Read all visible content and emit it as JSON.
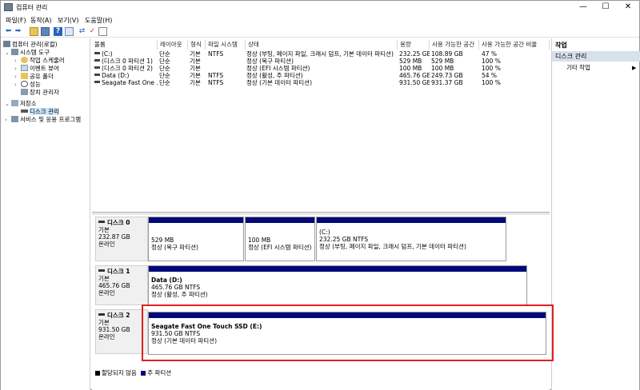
{
  "window": {
    "title": "컴퓨터 관리",
    "minimize": "—",
    "maximize": "☐",
    "close": "✕"
  },
  "menu": [
    "파일(F)",
    "동작(A)",
    "보기(V)",
    "도움말(H)"
  ],
  "tree": {
    "root": "컴퓨터 관리(로컬)",
    "system_tools": "시스템 도구",
    "task_scheduler": "작업 스케줄러",
    "event_viewer": "이벤트 뷰어",
    "shared_folders": "공유 폴더",
    "performance": "성능",
    "device_manager": "장치 관리자",
    "storage": "저장소",
    "disk_management": "디스크 관리",
    "services": "서비스 및 응용 프로그램"
  },
  "volume_table": {
    "columns": [
      "볼륨",
      "레이아웃",
      "형식",
      "파일 시스템",
      "상태",
      "용량",
      "사용 가능한 공간",
      "사용 가능한 공간 비율"
    ],
    "rows": [
      {
        "volume": "(C:)",
        "layout": "단순",
        "type": "기본",
        "fs": "NTFS",
        "status": "정상 (부팅, 페이지 파일, 크래시 덤프, 기본 데이터 파티션)",
        "capacity": "232.25 GB",
        "free": "108.89 GB",
        "pct": "47 %"
      },
      {
        "volume": "(디스크 0 파티션 1)",
        "layout": "단순",
        "type": "기본",
        "fs": "",
        "status": "정상 (복구 파티션)",
        "capacity": "529 MB",
        "free": "529 MB",
        "pct": "100 %"
      },
      {
        "volume": "(디스크 0 파티션 2)",
        "layout": "단순",
        "type": "기본",
        "fs": "",
        "status": "정상 (EFI 시스템 파티션)",
        "capacity": "100 MB",
        "free": "100 MB",
        "pct": "100 %"
      },
      {
        "volume": "Data (D:)",
        "layout": "단순",
        "type": "기본",
        "fs": "NTFS",
        "status": "정상 (활성, 주 파티션)",
        "capacity": "465.76 GB",
        "free": "249.73 GB",
        "pct": "54 %"
      },
      {
        "volume": "Seagate Fast One ...",
        "layout": "단순",
        "type": "기본",
        "fs": "NTFS",
        "status": "정상 (기본 데이터 파티션)",
        "capacity": "931.50 GB",
        "free": "931.37 GB",
        "pct": "100 %"
      }
    ]
  },
  "disks": [
    {
      "name": "디스크 0",
      "kind": "기본",
      "size": "232.87 GB",
      "state": "온라인",
      "partitions": [
        {
          "line1": "529 MB",
          "line2": "정상 (복구 파티션)"
        },
        {
          "line1": "100 MB",
          "line2": "정상 (EFI 시스템 파티션)"
        },
        {
          "label": "(C:)",
          "line1": "232.25 GB NTFS",
          "line2": "정상 (부팅, 페이지 파일, 크래시 덤프, 기본 데이터 파티션)"
        }
      ]
    },
    {
      "name": "디스크 1",
      "kind": "기본",
      "size": "465.76 GB",
      "state": "온라인",
      "partitions": [
        {
          "label": "Data  (D:)",
          "line1": "465.76 GB NTFS",
          "line2": "정상 (활성, 주 파티션)"
        }
      ]
    },
    {
      "name": "디스크 2",
      "kind": "기본",
      "size": "931.50 GB",
      "state": "온라인",
      "partitions": [
        {
          "label": "Seagate Fast One Touch SSD  (E:)",
          "line1": "931.50 GB NTFS",
          "line2": "정상 (기본 데이터 파티션)"
        }
      ]
    }
  ],
  "legend": {
    "unallocated": "할당되지 않음",
    "primary": "주 파티션",
    "unallocated_color": "#000000",
    "primary_color": "#00087a"
  },
  "actions": {
    "header": "작업",
    "section": "디스크 관리",
    "item": "기타 작업"
  },
  "colors": {
    "partition_bar": "#00087a",
    "highlight_box": "#e02020",
    "selection": "#cce8ff",
    "actions_section": "#d6e1ec"
  },
  "icons": [
    "app-icon",
    "back-arrow-icon",
    "forward-arrow-icon",
    "up-folder-icon",
    "show-hide-tree-icon",
    "help-icon",
    "properties-icon",
    "connect-icon",
    "check-icon",
    "export-icon"
  ]
}
